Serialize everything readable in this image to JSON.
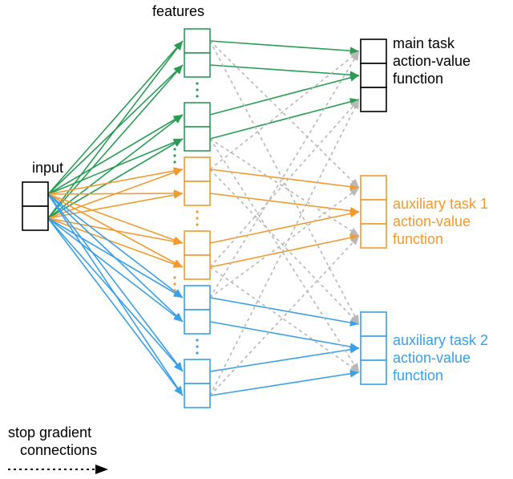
{
  "labels": {
    "features": "features",
    "input": "input",
    "main_task_l1": "main task",
    "main_task_l2": "action-value",
    "main_task_l3": "function",
    "aux1_l1": "auxiliary task 1",
    "aux1_l2": "action-value",
    "aux1_l3": "function",
    "aux2_l1": "auxiliary task 2",
    "aux2_l2": "action-value",
    "aux2_l3": "function",
    "stop_grad_l1": "stop gradient",
    "stop_grad_l2": "connections"
  },
  "colors": {
    "main": "#000000",
    "green": "#2a9d54",
    "orange": "#f29a2e",
    "blue": "#3aa0e8",
    "grey": "#b8b8b8"
  },
  "chart_data": {
    "type": "diagram",
    "nodes": {
      "input": {
        "cells": 2
      },
      "features": [
        {
          "name": "green",
          "cells_shown": 4,
          "ellipsis": true
        },
        {
          "name": "orange",
          "cells_shown": 4,
          "ellipsis": true
        },
        {
          "name": "blue",
          "cells_shown": 4,
          "ellipsis": true
        }
      ],
      "outputs": [
        {
          "name": "main_task",
          "cells": 3,
          "label": "main task action-value function"
        },
        {
          "name": "aux_task_1",
          "cells": 3,
          "label": "auxiliary task 1 action-value function"
        },
        {
          "name": "aux_task_2",
          "cells": 3,
          "label": "auxiliary task 2 action-value function"
        }
      ]
    },
    "edges": {
      "input_to_features": [
        {
          "from": "input",
          "to": "features.green",
          "style": "solid",
          "color": "green"
        },
        {
          "from": "input",
          "to": "features.orange",
          "style": "solid",
          "color": "orange"
        },
        {
          "from": "input",
          "to": "features.blue",
          "style": "solid",
          "color": "blue"
        }
      ],
      "features_to_outputs_direct": [
        {
          "from": "features.green",
          "to": "outputs.main_task",
          "style": "solid",
          "color": "green"
        },
        {
          "from": "features.orange",
          "to": "outputs.aux_task_1",
          "style": "solid",
          "color": "orange"
        },
        {
          "from": "features.blue",
          "to": "outputs.aux_task_2",
          "style": "solid",
          "color": "blue"
        }
      ],
      "features_to_outputs_stop_gradient": [
        {
          "from": "features.green",
          "to": "outputs.aux_task_1",
          "style": "dashed",
          "color": "grey"
        },
        {
          "from": "features.green",
          "to": "outputs.aux_task_2",
          "style": "dashed",
          "color": "grey"
        },
        {
          "from": "features.orange",
          "to": "outputs.main_task",
          "style": "dashed",
          "color": "grey"
        },
        {
          "from": "features.orange",
          "to": "outputs.aux_task_2",
          "style": "dashed",
          "color": "grey"
        },
        {
          "from": "features.blue",
          "to": "outputs.main_task",
          "style": "dashed",
          "color": "grey"
        },
        {
          "from": "features.blue",
          "to": "outputs.aux_task_1",
          "style": "dashed",
          "color": "grey"
        }
      ]
    },
    "legend": {
      "dashed_arrow": "stop gradient connections"
    }
  }
}
